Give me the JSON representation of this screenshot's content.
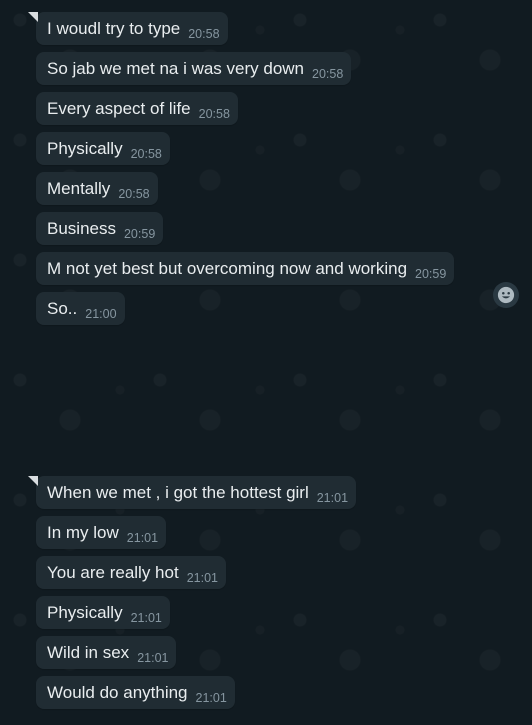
{
  "group1": {
    "messages": [
      {
        "text": "I woudl try to type",
        "time": "20:58"
      },
      {
        "text": "So jab we met na i was very down",
        "time": "20:58"
      },
      {
        "text": "Every aspect of life",
        "time": "20:58"
      },
      {
        "text": "Physically",
        "time": "20:58"
      },
      {
        "text": "Mentally",
        "time": "20:58"
      },
      {
        "text": "Business",
        "time": "20:59"
      },
      {
        "text": "M not yet best but overcoming now and working",
        "time": "20:59"
      },
      {
        "text": "So..",
        "time": "21:00"
      }
    ]
  },
  "group2": {
    "messages": [
      {
        "text": "When we met , i got the hottest girl",
        "time": "21:01"
      },
      {
        "text": "In my low",
        "time": "21:01"
      },
      {
        "text": "You are really hot",
        "time": "21:01"
      },
      {
        "text": "Physically",
        "time": "21:01"
      },
      {
        "text": "Wild in sex",
        "time": "21:01"
      },
      {
        "text": "Would do anything",
        "time": "21:01"
      }
    ]
  },
  "icons": {
    "reaction": "emoji-smile-icon"
  },
  "colors": {
    "background": "#111b21",
    "bubble": "#202c33",
    "text": "#e9edef",
    "time": "#8696a0"
  }
}
